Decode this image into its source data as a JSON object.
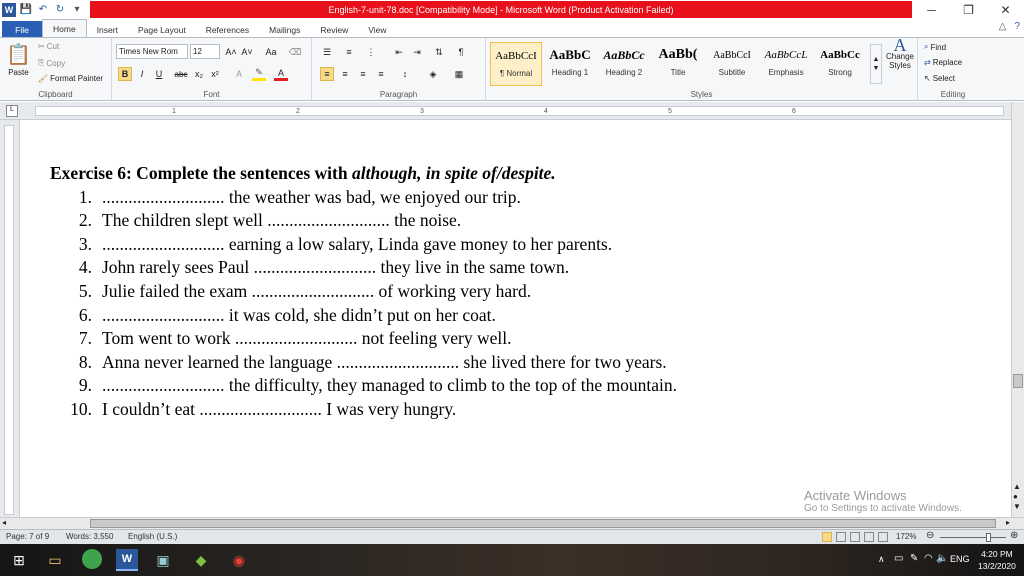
{
  "window": {
    "title": "English-7-unit-78.doc [Compatibility Mode] - Microsoft Word (Product Activation Failed)",
    "minimize": "─",
    "restore": "❐",
    "close": "✕"
  },
  "tabs": [
    "File",
    "Home",
    "Insert",
    "Page Layout",
    "References",
    "Mailings",
    "Review",
    "View"
  ],
  "ribbon": {
    "clipboard": {
      "label": "Clipboard",
      "paste": "Paste",
      "cut": "Cut",
      "copy": "Copy",
      "format_painter": "Format Painter"
    },
    "font": {
      "label": "Font",
      "font_name": "Times New Rom",
      "font_size": "12",
      "bold": "B",
      "italic": "I",
      "underline": "U",
      "strike": "abc",
      "sub": "x₂",
      "sup": "x²",
      "grow": "A˄",
      "shrink": "A˅",
      "case": "Aa"
    },
    "paragraph": {
      "label": "Paragraph"
    },
    "styles": {
      "label": "Styles",
      "items": [
        {
          "preview": "AaBbCcI",
          "name": "¶ Normal"
        },
        {
          "preview": "AaBbC",
          "name": "Heading 1"
        },
        {
          "preview": "AaBbCc",
          "name": "Heading 2"
        },
        {
          "preview": "AaBb(",
          "name": "Title"
        },
        {
          "preview": "AaBbCcI",
          "name": "Subtitle"
        },
        {
          "preview": "AaBbCcL",
          "name": "Emphasis"
        },
        {
          "preview": "AaBbCc",
          "name": "Strong"
        }
      ],
      "change_styles": "Change Styles"
    },
    "editing": {
      "label": "Editing",
      "find": "Find",
      "replace": "Replace",
      "select": "Select"
    }
  },
  "ruler": {
    "numbers": [
      "1",
      "2",
      "3",
      "4",
      "5",
      "6"
    ]
  },
  "document": {
    "title_prefix": "Exercise 6: Complete the sentences with ",
    "title_italic": "although, in spite of/despite.",
    "items": [
      {
        "num": "1.",
        "text": "............................ the weather was bad, we enjoyed our trip."
      },
      {
        "num": "2.",
        "text": "The children slept well ............................ the noise."
      },
      {
        "num": "3.",
        "text": "............................ earning a low salary, Linda gave money to her parents."
      },
      {
        "num": "4.",
        "text": "John rarely sees Paul ............................ they live in the same town."
      },
      {
        "num": "5.",
        "text": "Julie failed the exam ............................ of working very hard."
      },
      {
        "num": "6.",
        "text": "............................ it was cold, she didn’t put on her coat."
      },
      {
        "num": "7.",
        "text": "Tom went to work ............................ not feeling very well."
      },
      {
        "num": "8.",
        "text": "Anna never learned the language ............................ she lived there for two years."
      },
      {
        "num": "9.",
        "text": "............................ the difficulty, they managed to climb to the top of the mountain."
      },
      {
        "num": "10.",
        "text": "I couldn’t eat ............................ I was very hungry."
      }
    ]
  },
  "watermark": {
    "line1": "Activate Windows",
    "line2": "Go to Settings to activate Windows."
  },
  "status": {
    "page": "Page: 7 of 9",
    "words": "Words: 3,550",
    "language": "English (U.S.)",
    "zoom": "172%"
  },
  "taskbar": {
    "language": "ENG",
    "time": "4:20 PM",
    "date": "13/2/2020"
  }
}
